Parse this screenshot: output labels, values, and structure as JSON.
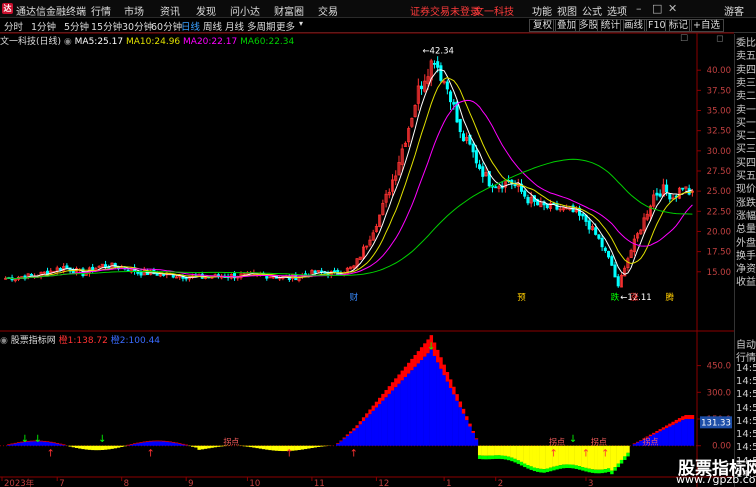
{
  "titlebar": {
    "app_name": "通达信金融终端",
    "menus": [
      "行情",
      "市场",
      "资讯",
      "发现",
      "问小达",
      "财富圈",
      "交易"
    ],
    "alert": "证券交易未登录",
    "stock_name": "文一科技",
    "right_items": [
      "功能",
      "视图",
      "公式",
      "选项"
    ],
    "user": "游客"
  },
  "toolbar": {
    "periods": [
      "分时",
      "1分钟",
      "5分钟",
      "15分钟",
      "30分钟",
      "60分钟",
      "日线",
      "周线",
      "月线",
      "多周期",
      "更多"
    ],
    "active_period": "日线",
    "buttons": [
      "复权",
      "叠加",
      "多股",
      "统计",
      "画线",
      "F10",
      "标记",
      "+自选"
    ]
  },
  "main_chart": {
    "title": "文一科技(日线)",
    "ma": [
      {
        "label": "MA5:",
        "value": "25.17",
        "color": "#ffffff"
      },
      {
        "label": "MA10:",
        "value": "24.96",
        "color": "#e0e000"
      },
      {
        "label": "MA20:",
        "value": "22.17",
        "color": "#ff00ff"
      },
      {
        "label": "MA60:",
        "value": "22.34",
        "color": "#00d000"
      }
    ],
    "price_ticks": [
      "40.00",
      "37.50",
      "35.00",
      "32.50",
      "30.00",
      "27.50",
      "25.00",
      "22.50",
      "20.00",
      "17.50",
      "15.00"
    ],
    "high_label": "42.34",
    "low_label": "12.11",
    "events": [
      "财",
      "预",
      "跌",
      "涨",
      "腾"
    ]
  },
  "indicator": {
    "name": "股票指标网",
    "v1_label": "橙1:",
    "v1": "138.72",
    "v2_label": "橙2:",
    "v2": "100.44",
    "ticks": [
      "450.0",
      "300.0",
      "150.0",
      "0.00"
    ],
    "current_value": "131.33",
    "signal_text": "拐点"
  },
  "x_axis": {
    "labels": [
      "2023年",
      "7",
      "8",
      "9",
      "10",
      "11",
      "12",
      "1",
      "2",
      "3"
    ]
  },
  "right_panel": {
    "top_items": [
      "委比",
      "卖五",
      "卖四",
      "卖三",
      "卖二",
      "卖一",
      "买一",
      "买二",
      "买三",
      "买四",
      "买五",
      "现价",
      "涨跌",
      "涨幅",
      "总量",
      "外盘",
      "换手",
      "净资",
      "收益"
    ],
    "bottom_items": [
      "自动",
      "行情",
      "14:5",
      "14:5",
      "14:5",
      "14:5",
      "14:5",
      "14:5",
      "14:5",
      "14:5",
      "14:5"
    ]
  },
  "watermark": {
    "title": "股票指标网",
    "url": "www.7gpzb.com"
  },
  "colors": {
    "up": "#ff3232",
    "down": "#00ffff",
    "ma5": "#ffffff",
    "ma10": "#e0e000",
    "ma20": "#ff00ff",
    "ma60": "#00d000",
    "ind_blue": "#0000ff",
    "ind_red": "#ff0000",
    "ind_yellow": "#ffff00",
    "ind_green": "#00ff00"
  }
}
